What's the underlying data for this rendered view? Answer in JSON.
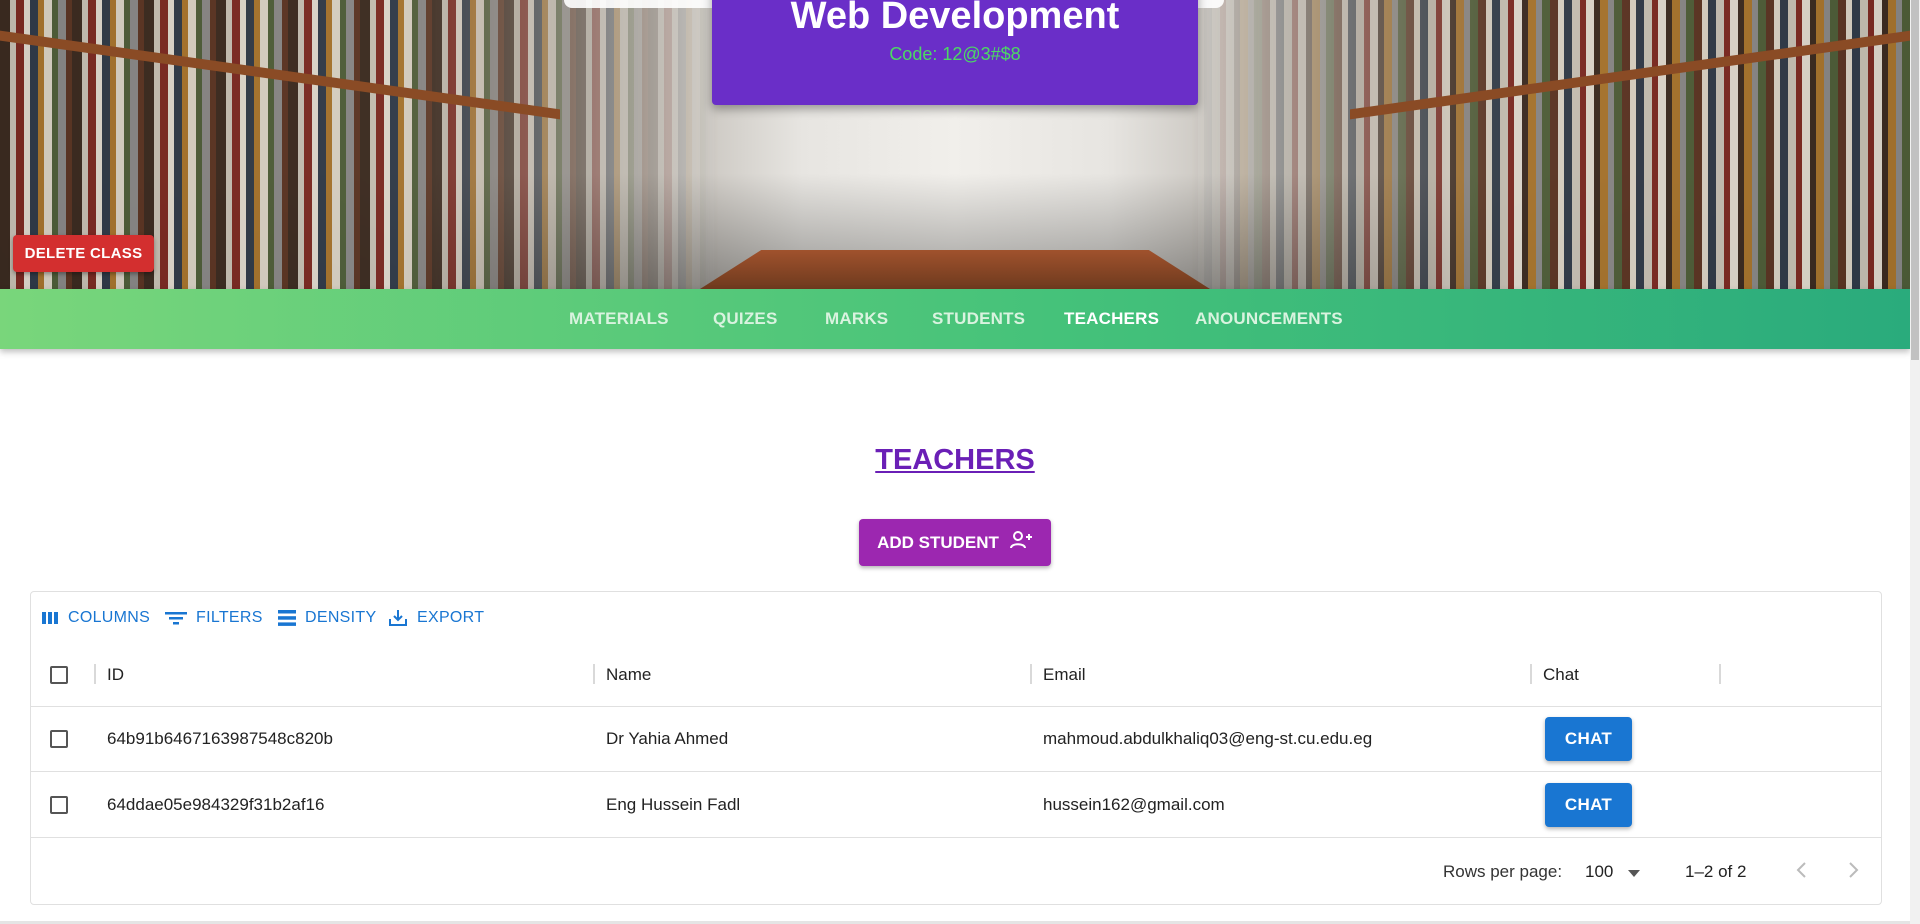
{
  "class": {
    "title": "Web Development",
    "code": "Code: 12@3#$8"
  },
  "hero": {
    "delete_label": "DELETE CLASS"
  },
  "tabs": [
    {
      "label": "MATERIALS",
      "active": false
    },
    {
      "label": "QUIZES",
      "active": false
    },
    {
      "label": "MARKS",
      "active": false
    },
    {
      "label": "STUDENTS",
      "active": false
    },
    {
      "label": "TEACHERS",
      "active": true
    },
    {
      "label": "ANOUNCEMENTS",
      "active": false
    }
  ],
  "section": {
    "title": "TEACHERS",
    "add_label": "ADD STUDENT",
    "add_icon": "person-add-icon"
  },
  "toolbar": {
    "columns": "COLUMNS",
    "filters": "FILTERS",
    "density": "DENSITY",
    "export": "EXPORT"
  },
  "table": {
    "columns": [
      "ID",
      "Name",
      "Email",
      "Chat"
    ],
    "rows": [
      {
        "id": "64b91b6467163987548c820b",
        "name": "Dr Yahia Ahmed",
        "email": "mahmoud.abdulkhaliq03@eng-st.cu.edu.eg",
        "chat": "CHAT"
      },
      {
        "id": "64ddae05e984329f31b2af16",
        "name": "Eng Hussein Fadl",
        "email": "hussein162@gmail.com",
        "chat": "CHAT"
      }
    ]
  },
  "pagination": {
    "rows_per_page_label": "Rows per page:",
    "rows_per_page": "100",
    "range": "1–2 of 2"
  },
  "colors": {
    "card": "#6a2ec8",
    "code_text": "#4cd964",
    "delete": "#d32f2f",
    "tab_gradient_start": "#79d67b",
    "tab_gradient_end": "#2aab7c",
    "add_button": "#9c27b0",
    "primary": "#1976d2",
    "title": "#6a1fb6"
  }
}
